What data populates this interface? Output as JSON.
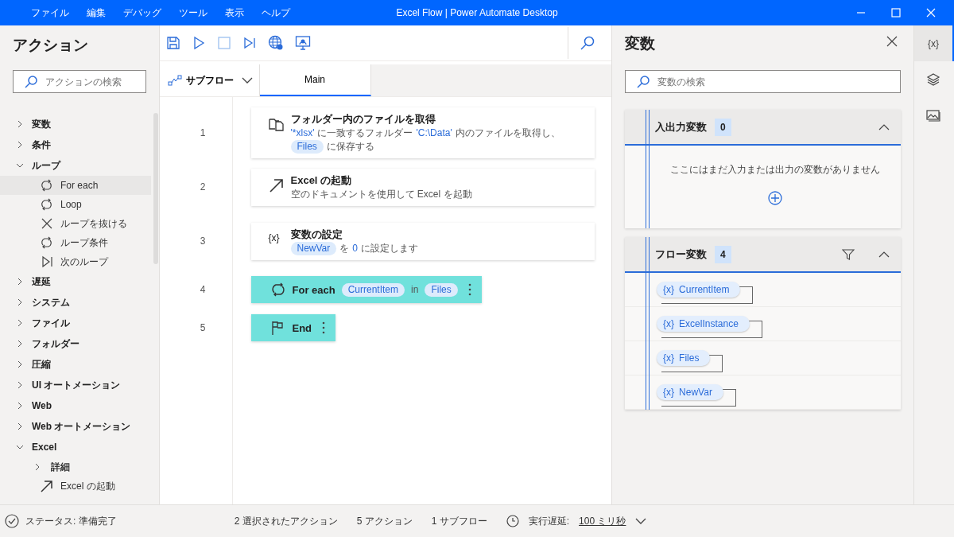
{
  "window": {
    "title": "Excel Flow | Power Automate Desktop"
  },
  "menu": [
    "ファイル",
    "編集",
    "デバッグ",
    "ツール",
    "表示",
    "ヘルプ"
  ],
  "actions_panel": {
    "title": "アクション",
    "search": {
      "placeholder": "アクションの検索"
    },
    "tree": [
      {
        "label": "変数",
        "expanded": false
      },
      {
        "label": "条件",
        "expanded": false
      },
      {
        "label": "ループ",
        "expanded": true,
        "children": [
          {
            "kind": "action",
            "label": "For each",
            "selected": true
          },
          {
            "kind": "action",
            "label": "Loop",
            "selected": false
          },
          {
            "kind": "action",
            "label": "ループを抜ける",
            "selected": false
          },
          {
            "kind": "action",
            "label": "ループ条件",
            "selected": false
          },
          {
            "kind": "action",
            "label": "次のループ",
            "selected": false
          }
        ]
      },
      {
        "label": "遅延",
        "expanded": false
      },
      {
        "label": "システム",
        "expanded": false
      },
      {
        "label": "ファイル",
        "expanded": false
      },
      {
        "label": "フォルダー",
        "expanded": false
      },
      {
        "label": "圧縮",
        "expanded": false
      },
      {
        "label": "UI オートメーション",
        "expanded": false
      },
      {
        "label": "Web",
        "expanded": false
      },
      {
        "label": "Web オートメーション",
        "expanded": false
      },
      {
        "label": "Excel",
        "expanded": true,
        "children": [
          {
            "kind": "group",
            "label": "詳細",
            "selected": false
          },
          {
            "kind": "action",
            "label": "Excel の起動",
            "selected": false
          }
        ]
      }
    ]
  },
  "subflow_tabs": {
    "dropdown": "サブフロー",
    "tabs": [
      {
        "label": "Main",
        "selected": true
      }
    ]
  },
  "steps": [
    {
      "number": "1",
      "kind": "action",
      "title": "フォルダー内のファイルを取得",
      "selected": false,
      "description": [
        {
          "kind": "literal",
          "text": "'*xlsx'"
        },
        {
          "kind": "text",
          "text": "に一致するフォルダー"
        },
        {
          "kind": "literal",
          "text": "'C:\\Data'"
        },
        {
          "kind": "text",
          "text": "内のファイルを取得し、"
        },
        {
          "kind": "var",
          "text": "Files"
        },
        {
          "kind": "text",
          "text": "に保存する"
        }
      ]
    },
    {
      "number": "2",
      "kind": "action",
      "title": "Excel の起動",
      "selected": false,
      "description": [
        {
          "kind": "text",
          "text": "空のドキュメントを使用して Excel を起動"
        }
      ]
    },
    {
      "number": "3",
      "kind": "action",
      "icon_text": "{x}",
      "title": "変数の設定",
      "selected": false,
      "description": [
        {
          "kind": "var",
          "text": "NewVar"
        },
        {
          "kind": "text",
          "text": "を"
        },
        {
          "kind": "literal",
          "text": "0"
        },
        {
          "kind": "text",
          "text": "に設定します"
        }
      ]
    },
    {
      "number": "4",
      "kind": "block",
      "title": "For each",
      "selected": true,
      "description": [
        {
          "kind": "var",
          "text": "CurrentItem"
        },
        {
          "kind": "text",
          "text": "in"
        },
        {
          "kind": "var",
          "text": "Files"
        }
      ]
    },
    {
      "number": "5",
      "kind": "block",
      "title": "End",
      "selected": true
    }
  ],
  "variables_panel": {
    "title": "変数",
    "search": {
      "placeholder": "変数の検索"
    },
    "sections": [
      {
        "title": "入出力変数",
        "count": "0",
        "expanded": true,
        "filter": false,
        "empty_text": "ここにはまだ入力または出力の変数がありません"
      },
      {
        "title": "フロー変数",
        "count": "4",
        "expanded": true,
        "filter": true,
        "variables": [
          {
            "prefix": "{x}",
            "name": "CurrentItem"
          },
          {
            "prefix": "{x}",
            "name": "ExcelInstance"
          },
          {
            "prefix": "{x}",
            "name": "Files"
          },
          {
            "prefix": "{x}",
            "name": "NewVar"
          }
        ]
      }
    ]
  },
  "side_rail": [
    {
      "label": "{x}",
      "selected": true
    },
    {
      "selected": false
    },
    {
      "selected": false
    }
  ],
  "status_bar": {
    "status": "ステータス: 準備完了",
    "selected_actions": "2 選択されたアクション",
    "actions": "5 アクション",
    "subflows": "1 サブフロー",
    "delay_label": "実行遅延:",
    "delay_value": "100 ミリ秒"
  }
}
